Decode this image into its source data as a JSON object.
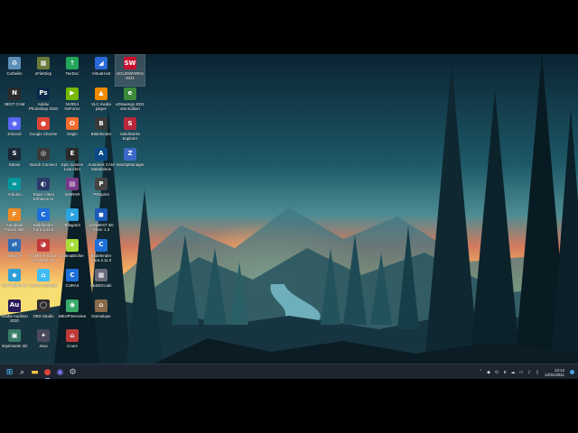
{
  "desktop": {
    "icons": [
      {
        "label": "Corbeille",
        "icon": "recycle-bin-icon",
        "glyph": "♻",
        "color": "#5b8fb8",
        "col": 0,
        "row": 0
      },
      {
        "label": "NEXT CAM",
        "icon": "next-cam-icon",
        "glyph": "N",
        "color": "#2a2a2a",
        "col": 0,
        "row": 1
      },
      {
        "label": "Discord",
        "icon": "discord-icon",
        "glyph": "◉",
        "color": "#5865f2",
        "col": 0,
        "row": 2
      },
      {
        "label": "Steam",
        "icon": "steam-icon",
        "glyph": "S",
        "color": "#1b2838",
        "col": 0,
        "row": 3
      },
      {
        "label": "Arduino",
        "icon": "arduino-icon",
        "glyph": "∞",
        "color": "#00979d",
        "col": 0,
        "row": 4
      },
      {
        "label": "Autodesk Fusion 360",
        "icon": "fusion-360-icon",
        "glyph": "F",
        "color": "#f08a24",
        "col": 0,
        "row": 5
      },
      {
        "label": "WinSCP",
        "icon": "winscp-icon",
        "glyph": "⇄",
        "color": "#2f6db5",
        "col": 0,
        "row": 6
      },
      {
        "label": "CHITUBOX 64",
        "icon": "chitubox-icon",
        "glyph": "◆",
        "color": "#2e9fd6",
        "col": 0,
        "row": 7
      },
      {
        "label": "Adobe Audition 2020",
        "icon": "audition-icon",
        "glyph": "Au",
        "color": "#2a1a5a",
        "col": 0,
        "row": 8
      },
      {
        "label": "Imprimante 3D",
        "icon": "printer-3d-icon",
        "glyph": "▣",
        "color": "#3a7d6a",
        "col": 0,
        "row": 9
      },
      {
        "label": "eFileDisp",
        "icon": "efile-icon",
        "glyph": "▦",
        "color": "#6a7a3a",
        "col": 1,
        "row": 0
      },
      {
        "label": "Adobe Photoshop 2020",
        "icon": "photoshop-icon",
        "glyph": "Ps",
        "color": "#0b2a4a",
        "col": 1,
        "row": 1
      },
      {
        "label": "Google Chrome",
        "icon": "chrome-icon",
        "glyph": "●",
        "color": "#db4437",
        "col": 1,
        "row": 2
      },
      {
        "label": "Bosch Connect",
        "icon": "bosch-icon",
        "glyph": "◎",
        "color": "#3a3a3a",
        "col": 1,
        "row": 3
      },
      {
        "label": "Topaz Video Enhance AI",
        "icon": "topaz-icon",
        "glyph": "◐",
        "color": "#2a3a6a",
        "col": 1,
        "row": 4
      },
      {
        "label": "Bitdefender Cura 4.11.0",
        "icon": "cura-icon",
        "glyph": "C",
        "color": "#1e6fd9",
        "col": 1,
        "row": 5
      },
      {
        "label": "AOMEI Partition Assistant 9.8",
        "icon": "aomei-icon",
        "glyph": "◕",
        "color": "#c23b3b",
        "col": 1,
        "row": 6
      },
      {
        "label": "Home Assistant",
        "icon": "home-assistant-icon",
        "glyph": "⌂",
        "color": "#41bdf5",
        "col": 1,
        "row": 7
      },
      {
        "label": "OBS Studio",
        "icon": "obs-icon",
        "glyph": "◯",
        "color": "#302e31",
        "col": 1,
        "row": 8
      },
      {
        "label": "Jeux",
        "icon": "gamepad-icon",
        "glyph": "✦",
        "color": "#4a4a5a",
        "col": 1,
        "row": 9
      },
      {
        "label": "TeeDoc",
        "icon": "teedoc-icon",
        "glyph": "↑",
        "color": "#23a55a",
        "col": 2,
        "row": 0
      },
      {
        "label": "NVIDIA GeForce Experience",
        "icon": "nvidia-icon",
        "glyph": "▶",
        "color": "#76b900",
        "col": 2,
        "row": 1
      },
      {
        "label": "Origin",
        "icon": "origin-icon",
        "glyph": "O",
        "color": "#f56c2d",
        "col": 2,
        "row": 2
      },
      {
        "label": "Epic Games Launcher",
        "icon": "epic-games-icon",
        "glyph": "E",
        "color": "#2a2a2a",
        "col": 2,
        "row": 3
      },
      {
        "label": "WinRAR",
        "icon": "winrar-icon",
        "glyph": "▤",
        "color": "#7a3a8a",
        "col": 2,
        "row": 4
      },
      {
        "label": "Telegram",
        "icon": "telegram-icon",
        "glyph": "➤",
        "color": "#2aa3df",
        "col": 2,
        "row": 5
      },
      {
        "label": "balenaEtcher",
        "icon": "etcher-icon",
        "glyph": "◈",
        "color": "#a5de37",
        "col": 2,
        "row": 6
      },
      {
        "label": "CURA4",
        "icon": "cura4-icon",
        "glyph": "C",
        "color": "#1e6fd9",
        "col": 2,
        "row": 7
      },
      {
        "label": "MEUPInterview",
        "icon": "meup-icon",
        "glyph": "◉",
        "color": "#3aaa6a",
        "col": 2,
        "row": 8
      },
      {
        "label": "Cours",
        "icon": "home-course-icon",
        "glyph": "⌂",
        "color": "#c03a3a",
        "col": 2,
        "row": 9
      },
      {
        "label": "VirtuaHost",
        "icon": "virtuahost-icon",
        "glyph": "◢",
        "color": "#2a6ad8",
        "col": 3,
        "row": 0
      },
      {
        "label": "VLC media player",
        "icon": "vlc-icon",
        "glyph": "▲",
        "color": "#f08a00",
        "col": 3,
        "row": 1
      },
      {
        "label": "Bitdefender",
        "icon": "bitdefender-icon",
        "glyph": "B",
        "color": "#3a3a3a",
        "col": 3,
        "row": 2
      },
      {
        "label": "Autodesk CAM Standalone Software",
        "icon": "autodesk-cam-icon",
        "glyph": "A",
        "color": "#0a4a8a",
        "col": 3,
        "row": 3
      },
      {
        "label": "PRSprint",
        "icon": "prsprint-icon",
        "glyph": "P",
        "color": "#444444",
        "col": 3,
        "row": 4
      },
      {
        "label": "LCNBEST 3D Slicer 1.3",
        "icon": "slicer-icon",
        "glyph": "◼",
        "color": "#1a5ab8",
        "col": 3,
        "row": 5
      },
      {
        "label": "Bitdefender Cura 4.11.0",
        "icon": "cura-alt-icon",
        "glyph": "C",
        "color": "#1e6fd9",
        "col": 3,
        "row": 6
      },
      {
        "label": "MultiOCode",
        "icon": "multiocode-icon",
        "glyph": "▦",
        "color": "#6a6a7a",
        "col": 3,
        "row": 7
      },
      {
        "label": "Domotique",
        "icon": "domotique-icon",
        "glyph": "⌂",
        "color": "#8a6a4a",
        "col": 3,
        "row": 8
      },
      {
        "label": "SOLIDWORKS 2021",
        "icon": "solidworks-icon",
        "glyph": "SW",
        "color": "#c8102e",
        "col": 4,
        "row": 0
      },
      {
        "label": "eDrawings 2021 x64 Edition",
        "icon": "edrawings-icon",
        "glyph": "e",
        "color": "#3a8a3a",
        "col": 4,
        "row": 1
      },
      {
        "label": "SolidWorks Explorer",
        "icon": "sw-explorer-icon",
        "glyph": "S",
        "color": "#b8283a",
        "col": 4,
        "row": 2
      },
      {
        "label": "WinZipManager",
        "icon": "winzip-icon",
        "glyph": "Z",
        "color": "#3a6ac8",
        "col": 4,
        "row": 3
      }
    ]
  },
  "taskbar": {
    "apps": [
      {
        "icon": "windows-start-icon",
        "glyph": "⊞",
        "color": "#4cc2ff",
        "active": false
      },
      {
        "icon": "search-icon",
        "glyph": "⌕",
        "color": "#e6edf3",
        "active": false
      },
      {
        "icon": "file-explorer-icon",
        "glyph": "▬",
        "color": "#f5c542",
        "active": false
      },
      {
        "icon": "chrome-icon",
        "glyph": "●",
        "color": "#db4437",
        "active": true
      },
      {
        "icon": "camera-app-icon",
        "glyph": "◉",
        "color": "#7a7aff",
        "active": false
      },
      {
        "icon": "settings-gear-icon",
        "glyph": "⚙",
        "color": "#c0c8d0",
        "active": false
      }
    ],
    "tray": [
      {
        "icon": "chevron-up-icon",
        "glyph": "˄"
      },
      {
        "icon": "security-icon",
        "glyph": "◆"
      },
      {
        "icon": "app-tray-icon",
        "glyph": "⊙"
      },
      {
        "icon": "bluetooth-icon",
        "glyph": "ʙ"
      },
      {
        "icon": "onedrive-icon",
        "glyph": "☁"
      },
      {
        "icon": "network-icon",
        "glyph": "▭"
      },
      {
        "icon": "volume-icon",
        "glyph": "♪"
      },
      {
        "icon": "battery-icon",
        "glyph": "▯"
      }
    ],
    "time": "12:14",
    "date": "12/31/2021"
  }
}
